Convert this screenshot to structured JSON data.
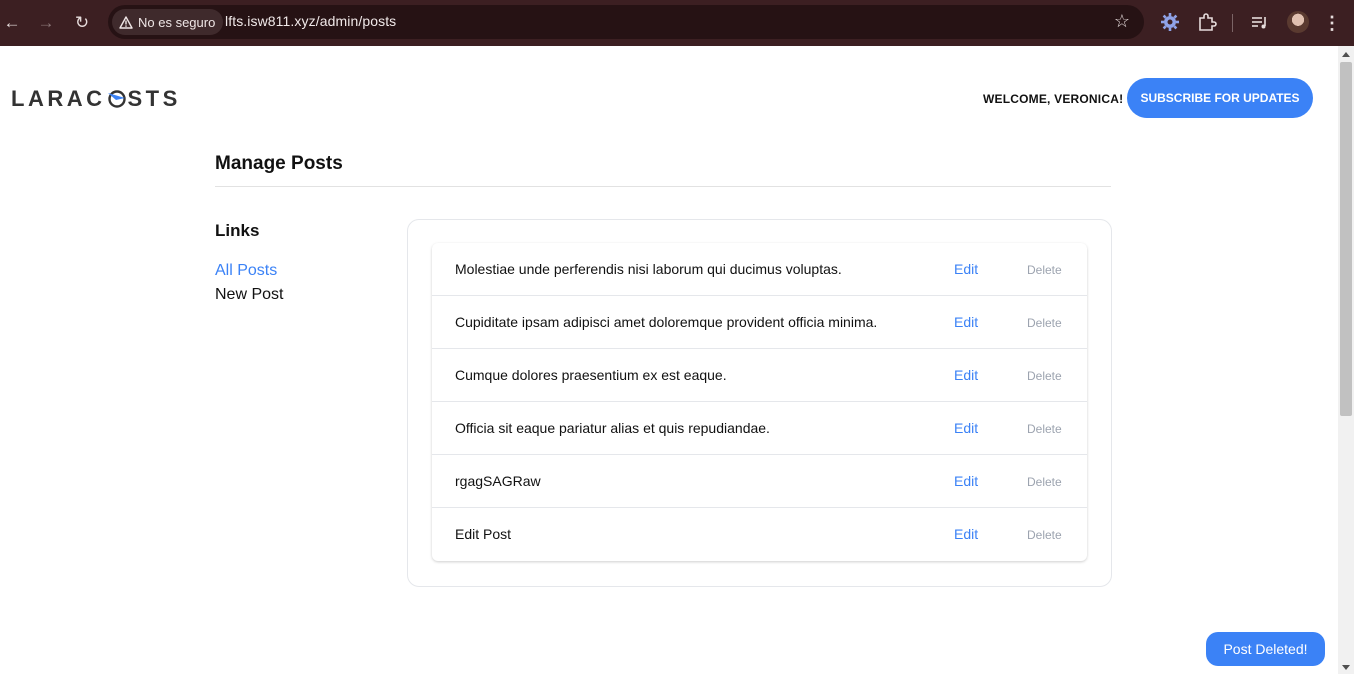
{
  "browser": {
    "security_label": "No es seguro",
    "url": "lfts.isw811.xyz/admin/posts"
  },
  "header": {
    "logo_text_left": "LARAC",
    "logo_text_right": "STS",
    "welcome": "Welcome, Veronica!",
    "subscribe_label": "Subscribe for Updates"
  },
  "page": {
    "title": "Manage Posts"
  },
  "sidebar": {
    "heading": "Links",
    "items": [
      {
        "label": "All Posts",
        "active": true
      },
      {
        "label": "New Post",
        "active": false
      }
    ]
  },
  "posts": [
    {
      "title": "Molestiae unde perferendis nisi laborum qui ducimus voluptas.",
      "edit_label": "Edit",
      "delete_label": "Delete"
    },
    {
      "title": "Cupiditate ipsam adipisci amet doloremque provident officia minima.",
      "edit_label": "Edit",
      "delete_label": "Delete"
    },
    {
      "title": "Cumque dolores praesentium ex est eaque.",
      "edit_label": "Edit",
      "delete_label": "Delete"
    },
    {
      "title": "Officia sit eaque pariatur alias et quis repudiandae.",
      "edit_label": "Edit",
      "delete_label": "Delete"
    },
    {
      "title": "rgagSAGRaw",
      "edit_label": "Edit",
      "delete_label": "Delete"
    },
    {
      "title": "Edit Post",
      "edit_label": "Edit",
      "delete_label": "Delete"
    }
  ],
  "toast": {
    "message": "Post Deleted!"
  },
  "colors": {
    "accent": "#3b82f6",
    "chrome_bg": "#3c1f22",
    "muted": "#9ca3af"
  }
}
